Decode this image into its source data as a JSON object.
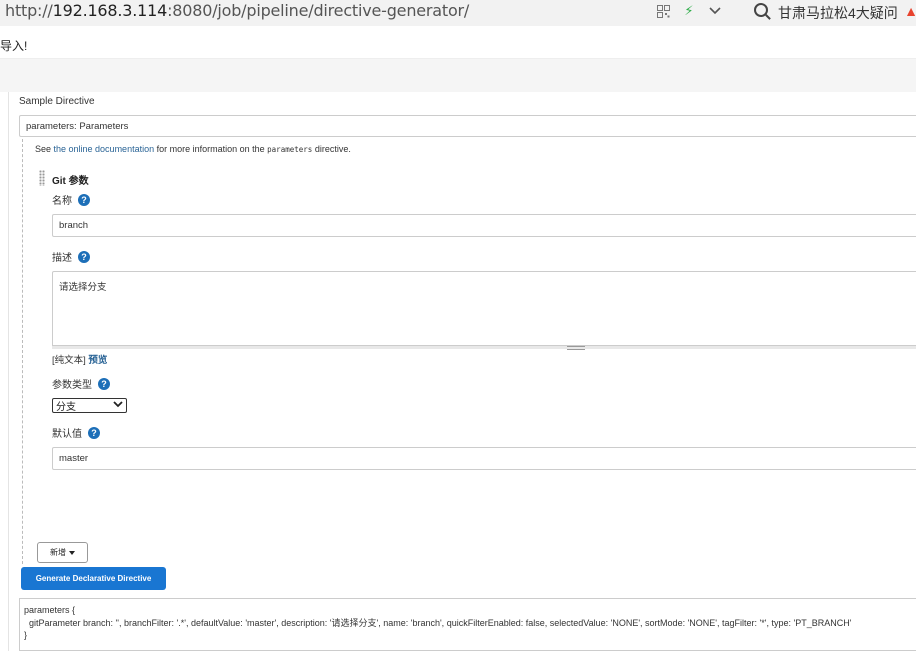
{
  "browser": {
    "url_prefix": "http://",
    "url_host": "192.168.3.114",
    "url_rest": ":8080/job/pipeline/directive-generator/",
    "search_text": "甘肃马拉松4大疑问"
  },
  "notice": "导入!",
  "form": {
    "sample_label": "Sample Directive",
    "directive_value": "parameters: Parameters",
    "doc_see": "See ",
    "doc_link": "the online documentation",
    "doc_mid": " for more information on the ",
    "doc_code": "parameters",
    "doc_end": " directive.",
    "section_title": "Git 参数",
    "name_label": "名称",
    "name_value": "branch",
    "desc_label": "描述",
    "desc_value": "请选择分支",
    "format_plain": "[纯文本]",
    "format_preview": "预览",
    "type_label": "参数类型",
    "type_value": "分支",
    "default_label": "默认值",
    "default_value": "master",
    "help_glyph": "?",
    "add_label": "新增",
    "generate_label": "Generate Declarative Directive"
  },
  "output": {
    "line1": "parameters {",
    "line2": "  gitParameter branch: '', branchFilter: '.*', defaultValue: 'master', description: '请选择分支', name: 'branch', quickFilterEnabled: false, selectedValue: 'NONE', sortMode: 'NONE', tagFilter: '*', type: 'PT_BRANCH'",
    "line3": "}"
  },
  "colors": {
    "primary_button": "#1976d2",
    "link": "#2a6496",
    "help_icon": "#1d6fb8"
  }
}
